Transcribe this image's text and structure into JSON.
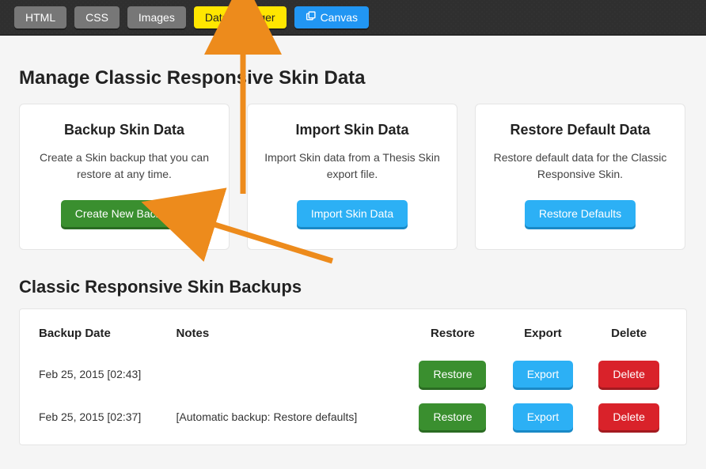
{
  "topbar": {
    "tabs": [
      {
        "label": "HTML"
      },
      {
        "label": "CSS"
      },
      {
        "label": "Images"
      },
      {
        "label": "Data Manager"
      },
      {
        "label": "Canvas"
      }
    ]
  },
  "page_title": "Manage Classic Responsive Skin Data",
  "cards": {
    "backup": {
      "title": "Backup Skin Data",
      "desc": "Create a Skin backup that you can restore at any time.",
      "button": "Create New Backup"
    },
    "import": {
      "title": "Import Skin Data",
      "desc": "Import Skin data from a Thesis Skin export file.",
      "button": "Import Skin Data"
    },
    "restore": {
      "title": "Restore Default Data",
      "desc": "Restore default data for the Classic Responsive Skin.",
      "button": "Restore Defaults"
    }
  },
  "backups": {
    "title": "Classic Responsive Skin Backups",
    "columns": {
      "date": "Backup Date",
      "notes": "Notes",
      "restore": "Restore",
      "export": "Export",
      "delete": "Delete"
    },
    "rows": [
      {
        "date": "Feb 25, 2015 [02:43]",
        "notes": " ",
        "restore": "Restore",
        "export": "Export",
        "delete": "Delete"
      },
      {
        "date": "Feb 25, 2015 [02:37]",
        "notes": "[Automatic backup: Restore defaults]",
        "restore": "Restore",
        "export": "Export",
        "delete": "Delete"
      }
    ]
  },
  "colors": {
    "highlight": "#ffe600",
    "green": "#3a8f2f",
    "blue": "#2cb0f5",
    "red": "#d9222a",
    "arrow": "#ed8b1c"
  }
}
